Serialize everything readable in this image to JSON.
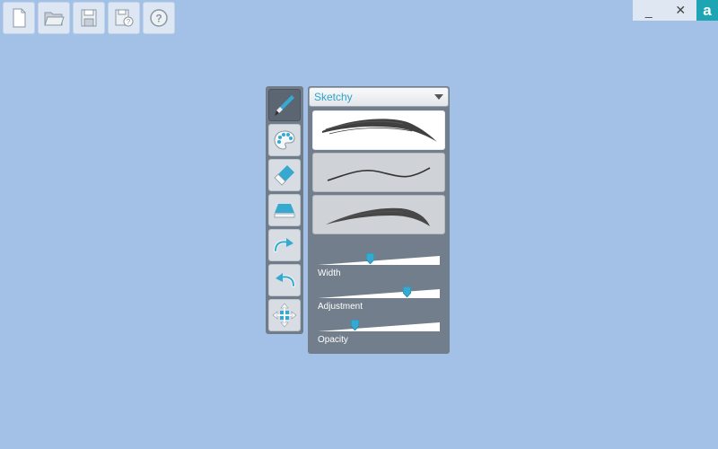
{
  "toolbar": {
    "buttons": [
      {
        "icon": "new-file-icon"
      },
      {
        "icon": "open-folder-icon"
      },
      {
        "icon": "save-icon"
      },
      {
        "icon": "save-as-icon"
      },
      {
        "icon": "help-icon",
        "label": "?"
      }
    ]
  },
  "window": {
    "minimize": "_",
    "close": "✕",
    "logo": "a"
  },
  "tools": [
    {
      "icon": "brush-icon",
      "active": true
    },
    {
      "icon": "palette-icon",
      "active": false
    },
    {
      "icon": "eraser-icon",
      "active": false
    },
    {
      "icon": "fill-icon",
      "active": false
    },
    {
      "icon": "redo-icon",
      "active": false
    },
    {
      "icon": "undo-icon",
      "active": false
    },
    {
      "icon": "move-icon",
      "active": false
    }
  ],
  "brush": {
    "selected": "Sketchy",
    "presets": [
      {
        "name": "thick-stroke",
        "selected": true
      },
      {
        "name": "thin-stroke",
        "selected": false
      },
      {
        "name": "feathered-stroke",
        "selected": false
      }
    ],
    "sliders": [
      {
        "label": "Width",
        "value": 0.43
      },
      {
        "label": "Adjustment",
        "value": 0.73
      },
      {
        "label": "Opacity",
        "value": 0.3
      }
    ]
  },
  "colors": {
    "background": "#a3c0e6",
    "panel": "#727e8b",
    "accent": "#2fa3c9",
    "logo": "#1ea5b3"
  }
}
